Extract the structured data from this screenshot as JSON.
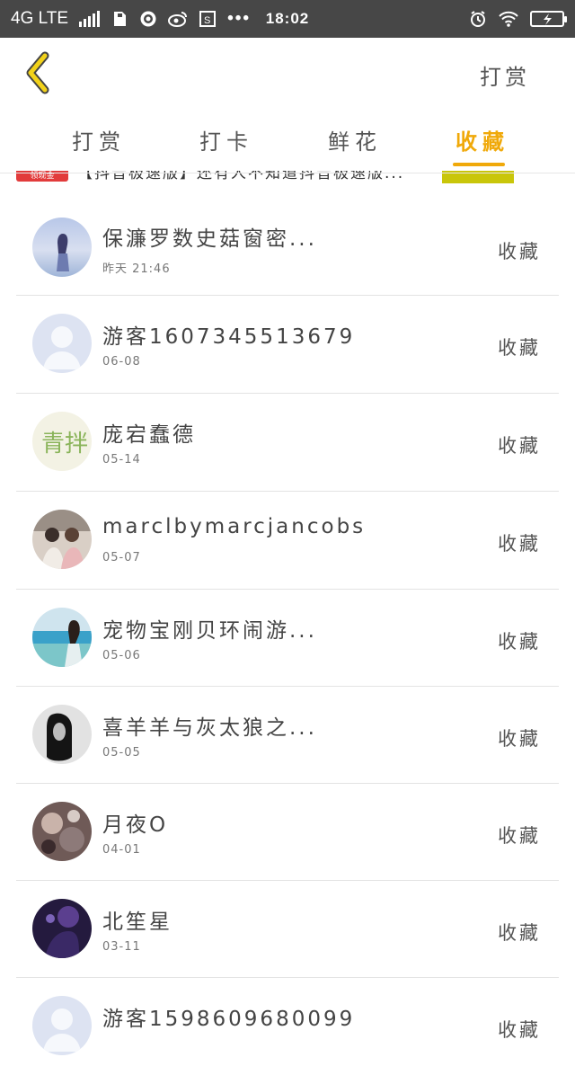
{
  "status_bar": {
    "network": "4G LTE",
    "time": "18:02",
    "icons": [
      "signal-icon",
      "sim-icon",
      "globe-icon",
      "weibo-icon",
      "screenshot-icon",
      "more-icon",
      "alarm-icon",
      "wifi-icon",
      "battery-charging-icon"
    ]
  },
  "header": {
    "back_icon": "back-chevron-icon",
    "action_label": "打赏",
    "accent_color": "#f0a90a"
  },
  "tabs": [
    {
      "label": "打赏",
      "active": false
    },
    {
      "label": "打卡",
      "active": false
    },
    {
      "label": "鲜花",
      "active": false
    },
    {
      "label": "收藏",
      "active": true
    }
  ],
  "ad": {
    "badge": "领现金",
    "text": "【抖音极速版】还有人不知道抖音极速版..."
  },
  "list": [
    {
      "name": "保濂罗数史菇窗密...",
      "time": "昨天  21:46",
      "action": "收藏",
      "avatar": "girl-seaside"
    },
    {
      "name": "游客1607345513679",
      "time": "06-08",
      "action": "收藏",
      "avatar": "default-person"
    },
    {
      "name": "庞宕蠢德",
      "time": "05-14",
      "action": "收藏",
      "avatar": "green-calligraphy"
    },
    {
      "name": "marclbymarcjancobs",
      "time": "05-07",
      "action": "收藏",
      "avatar": "couple-photo"
    },
    {
      "name": "宠物宝刚贝环闹游...",
      "time": "05-06",
      "action": "收藏",
      "avatar": "beach-girl"
    },
    {
      "name": "喜羊羊与灰太狼之...",
      "time": "05-05",
      "action": "收藏",
      "avatar": "bw-girl"
    },
    {
      "name": "月夜O",
      "time": "04-01",
      "action": "收藏",
      "avatar": "dark-collage"
    },
    {
      "name": "北笙星",
      "time": "03-11",
      "action": "收藏",
      "avatar": "purple-night"
    },
    {
      "name": "游客1598609680099",
      "time": "",
      "action": "收藏",
      "avatar": "default-person"
    }
  ]
}
